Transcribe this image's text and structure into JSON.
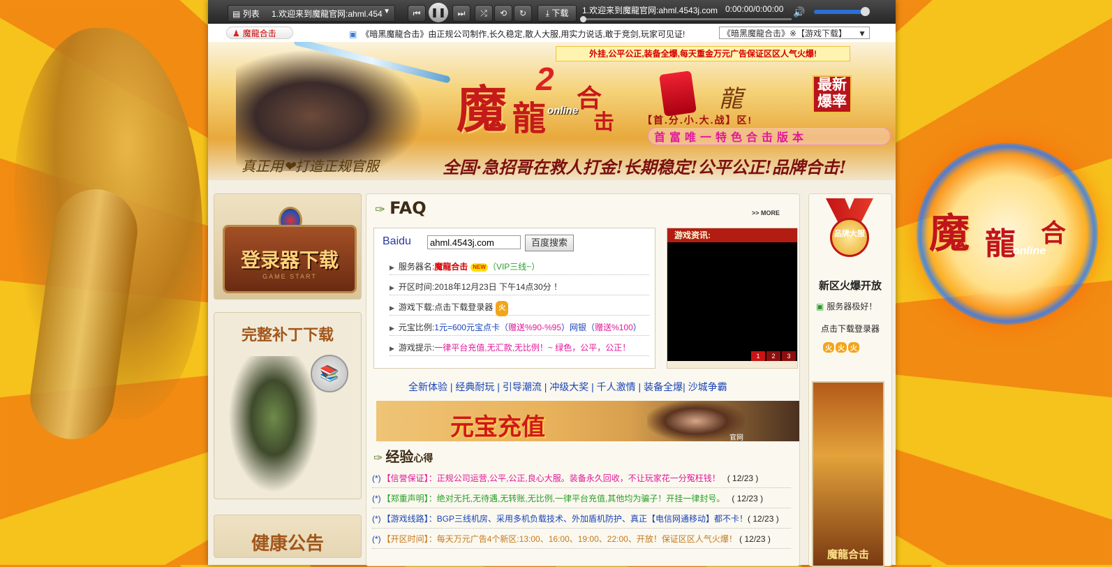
{
  "player": {
    "list_label": "列表",
    "track_select": "1.欢迎来到魔龍官网:ahml.454",
    "download_label": "下载",
    "now_playing": "1.欢迎来到魔龍官网:ahml.4543j.com",
    "time": "0:00:00/0:00:00",
    "volume": 0.95,
    "progress": 0.0
  },
  "marquee": {
    "tab_label": "魔龍合击",
    "text": "《暗黑魔龍合击》由正规公司制作,长久稳定,散人大服,用实力说话,敢于竞剑,玩家可见证!",
    "select_value": "《暗黑魔龍合击》※【游戏下载】"
  },
  "banner": {
    "notice": "外挂,公平公正,装备全爆,每天重金万元广告保证区区人气火爆!",
    "logo_main": "魔",
    "logo_second": "龍",
    "logo_num": "2",
    "logo_online": "online",
    "logo_he": "合",
    "logo_ji": "击",
    "slogan_dragon": "龍",
    "badge": "最新爆率",
    "sub1": "【首.分.小.大.战】区!",
    "sub2": "首富唯一特色合击版本",
    "left_slogan": "真正用❤打造正规官服",
    "right_slogan": "全国·急招哥在救人打金!长期稳定!公平公正!品牌合击!"
  },
  "side_logo": {
    "t1": "魔",
    "t2": "龍",
    "t3": "合",
    "t4": "online"
  },
  "left": {
    "login_download": "登录器下载",
    "login_sub": "GAME START",
    "patch_title": "完整补丁下载",
    "health_title": "健康公告"
  },
  "faq": {
    "title": "FAQ",
    "more": ">> MORE",
    "baidu_alt": "Baidu",
    "search_value": "ahml.4543j.com",
    "search_button": "百度搜索",
    "lines": [
      {
        "label": "服务器名:",
        "v1": "魔龍合击",
        "new": "NEW",
        "v2": "（VIP三线~）"
      },
      {
        "label": "开区时间:",
        "v1": "2018年12月23日 下午14点30分 ！"
      },
      {
        "label": "游戏下载:",
        "v1": "点击下载登录器",
        "fire": "火"
      },
      {
        "label": "元宝比例:",
        "v1": "1元=600元宝",
        "v2": "点卡（",
        "v3": "赠送%90-%95",
        "v4": "）网银（",
        "v5": "赠送%100",
        "v6": "）"
      },
      {
        "label": "游戏提示:",
        "v1": "一律平台充值,无汇款,无比例！~ 绿色，公平，公正！"
      }
    ]
  },
  "news": {
    "title": "游戏资讯:",
    "pages": [
      "1",
      "2",
      "3"
    ]
  },
  "tagline": "全新体验 | 经典耐玩 | 引导潮流 | 冲级大奖 | 千人激情 | 装备全爆| 沙城争霸",
  "recharge": {
    "title": "元宝充值",
    "caption": "官网"
  },
  "experience": {
    "title": "经验",
    "title_small": "心得",
    "items": [
      {
        "star": "(*)",
        "tag": "【信誉保证】",
        "text": "：正规公司运营,公平,公正,良心大服。装备永久回收，不让玩家花一分冤枉钱！",
        "date": "( 12/23 )"
      },
      {
        "star": "(*)",
        "tag": "【郑重声明】",
        "text": "：绝对无托,无待遇,无转账,无比例,一律平台充值,其他均为骗子！开挂一律封号。",
        "date": "( 12/23 )"
      },
      {
        "star": "(*)",
        "tag": "【游戏线路】",
        "text": "：BGP三线机房、采用多机负载技术、外加盾机防护、真正【电信网通移动】都不卡！",
        "date": "( 12/23 )"
      },
      {
        "star": "(*)",
        "tag": "【开区时间】",
        "text": "：每天万元广告4个新区:13:00、16:00、19:00、22:00、开放！保证区区人气火爆！",
        "date": "( 12/23 )"
      }
    ]
  },
  "right": {
    "medal": "品牌大服",
    "heading": "新区火爆开放",
    "server_ok": "服务器极好！",
    "download": "点击下载登录器",
    "fires": [
      "火",
      "火",
      "火"
    ],
    "dragon_caption": "魔龍合击"
  }
}
